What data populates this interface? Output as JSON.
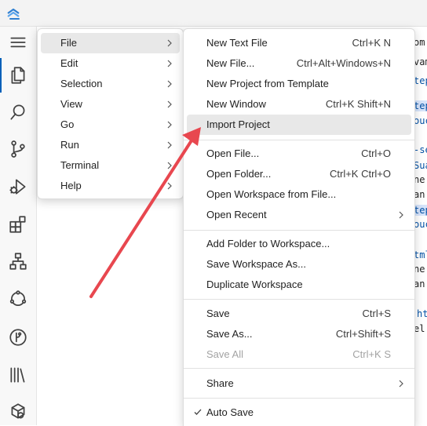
{
  "menubar": {
    "items": [
      {
        "label": "File"
      },
      {
        "label": "Edit"
      },
      {
        "label": "Selection"
      },
      {
        "label": "View"
      },
      {
        "label": "Go"
      },
      {
        "label": "Run"
      },
      {
        "label": "Terminal"
      },
      {
        "label": "Help"
      }
    ]
  },
  "file_menu": {
    "new_text_file": {
      "label": "New Text File",
      "shortcut": "Ctrl+K N"
    },
    "new_file": {
      "label": "New File...",
      "shortcut": "Ctrl+Alt+Windows+N"
    },
    "new_project_template": {
      "label": "New Project from Template"
    },
    "new_window": {
      "label": "New Window",
      "shortcut": "Ctrl+K Shift+N"
    },
    "import_project": {
      "label": "Import Project"
    },
    "open_file": {
      "label": "Open File...",
      "shortcut": "Ctrl+O"
    },
    "open_folder": {
      "label": "Open Folder...",
      "shortcut": "Ctrl+K Ctrl+O"
    },
    "open_workspace": {
      "label": "Open Workspace from File..."
    },
    "open_recent": {
      "label": "Open Recent"
    },
    "add_folder": {
      "label": "Add Folder to Workspace..."
    },
    "save_workspace_as": {
      "label": "Save Workspace As..."
    },
    "duplicate_workspace": {
      "label": "Duplicate Workspace"
    },
    "save": {
      "label": "Save",
      "shortcut": "Ctrl+S"
    },
    "save_as": {
      "label": "Save As...",
      "shortcut": "Ctrl+Shift+S"
    },
    "save_all": {
      "label": "Save All",
      "shortcut": "Ctrl+K S"
    },
    "share": {
      "label": "Share"
    },
    "auto_save": {
      "label": "Auto Save"
    }
  },
  "editor_fragments": [
    "om",
    "vam",
    "tep",
    "tep",
    "ouc",
    "-se",
    "Sua",
    "ne:",
    "an:",
    "tep",
    "ouc",
    "tml",
    "ne:",
    "an:",
    "ht",
    "el"
  ],
  "colors": {
    "accent": "#005fb8",
    "arrow": "#e8474f",
    "selection": "#e8e8e8"
  }
}
